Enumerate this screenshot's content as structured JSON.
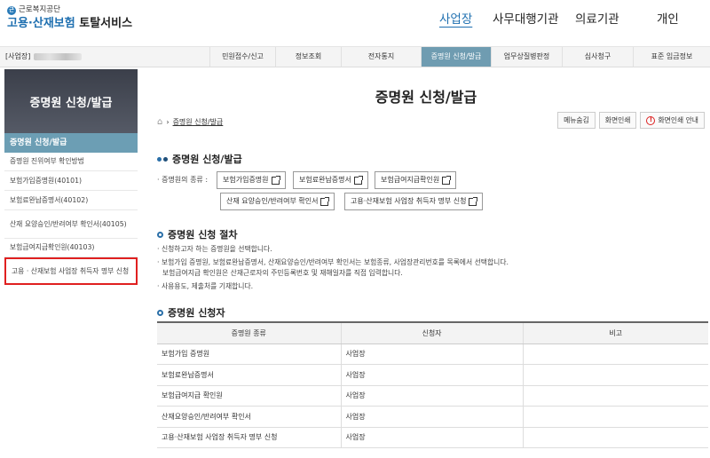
{
  "header": {
    "org": "근로복지공단",
    "service_blue": "고용·산재보험",
    "service_dark": "토탈서비스",
    "nav": [
      "사업장",
      "사무대행기관",
      "의료기관",
      "개인"
    ]
  },
  "menubar": {
    "biz_label": "[사업장]",
    "items": [
      "민원접수/신고",
      "정보조회",
      "전자통지",
      "증명원 신청/발급",
      "업무상질병판정",
      "심사청구",
      "표준 임금정보"
    ]
  },
  "sidebar": {
    "title": "증명원 신청/발급",
    "active": "증명원 신청/발급",
    "items": [
      "증명원 진위여부 확인방법",
      "보험가입증명원(40101)",
      "보험료완납증명서(40102)",
      "산재 요양승인/반려여부 확인서(40105)",
      "보험급여지급확인원(40103)",
      "고용 · 산재보험 사업장 취득자 명부 신청"
    ]
  },
  "main": {
    "title": "증명원 신청/발급",
    "breadcrumb": "증명원 신청/발급",
    "tools": [
      "메뉴숨김",
      "화면인쇄",
      "화면인쇄 안내"
    ],
    "section1_title": "증명원 신청/발급",
    "types_label": "· 증명원의 종류 :",
    "cert_buttons": [
      "보험가입증명원",
      "보험료완납증명서",
      "보험급여지급확인원",
      "산재 요양승인/반려여부 확인서",
      "고용·산재보험 사업장 취득자 명부 신청"
    ],
    "section2_title": "증명원 신청 절차",
    "procedure": [
      "· 신청하고자 하는 증명원을 선택합니다.",
      "· 보험가입 증명원, 보험료완납증명서, 산재요양승인/반려여부 확인서는 보험종류, 사업장관리번호를 목록에서 선택합니다.",
      "보험급여지급 확인원은 산재근로자의 주민등록번호 및 재해일자를 직접 입력합니다.",
      "· 사용용도, 제출처를 기재합니다."
    ],
    "section3_title": "증명원 신청자",
    "table": {
      "headers": [
        "증명원 종류",
        "신청자",
        "비고"
      ],
      "rows": [
        [
          "보험가입 증명원",
          "사업장",
          ""
        ],
        [
          "보험료완납증명서",
          "사업장",
          ""
        ],
        [
          "보험급여지급 확인원",
          "사업장",
          ""
        ],
        [
          "산재요양승인/반려여부 확인서",
          "사업장",
          ""
        ],
        [
          "고용·산재보험 사업장 취득자 명부 신청",
          "사업장",
          ""
        ]
      ]
    }
  },
  "colors": {
    "brand_blue": "#1e6fb0",
    "menu_active": "#6f9cb1",
    "sidebar_active": "#6c9eb4",
    "highlight_red": "#e02020"
  }
}
